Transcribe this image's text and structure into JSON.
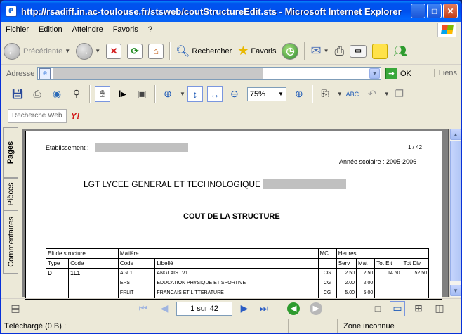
{
  "window": {
    "title": "http://rsadiff.in.ac-toulouse.fr/stsweb/coutStructureEdit.sts - Microsoft Internet Explorer",
    "minimize": "_",
    "maximize": "□",
    "close": "✕"
  },
  "menu": {
    "items": [
      "Fichier",
      "Edition",
      "Atteindre",
      "Favoris",
      "?"
    ]
  },
  "toolbar": {
    "back_label": "Précédente",
    "search_label": "Rechercher",
    "favorites_label": "Favoris"
  },
  "address": {
    "label": "Adresse",
    "go_label": "OK",
    "links_label": "Liens"
  },
  "pdf_toolbar": {
    "zoom_value": "75%"
  },
  "search_bar": {
    "button_label": "Recherche Web",
    "yahoo_label": "Y!"
  },
  "side_tabs": {
    "pages": "Pages",
    "attachments": "Pièces",
    "comments": "Commentaires"
  },
  "pdf": {
    "establishment_label": "Etablissement :",
    "page_count": "1 / 42",
    "school_year": "Année scolaire : 2005-2006",
    "school_name": "LGT LYCEE GENERAL ET TECHNOLOGIQUE",
    "doc_title": "COUT DE LA STRUCTURE",
    "table": {
      "header1": [
        "Elt de structure",
        "Matière",
        "MC",
        "Heures"
      ],
      "header2": [
        "Type",
        "Code",
        "Code",
        "Libellé",
        "Serv",
        "Mat",
        "Tot Elt",
        "Tot Div"
      ],
      "rows": [
        {
          "type": "D",
          "code": "1L1",
          "mcode": "AGL1",
          "libelle": "ANGLAIS LV1",
          "mc": "CG",
          "serv": "2.50",
          "mat": "2.50",
          "tot_elt": "14.50",
          "tot_div": "52.50"
        },
        {
          "type": "",
          "code": "",
          "mcode": "EPS",
          "libelle": "EDUCATION PHYSIQUE ET SPORTIVE",
          "mc": "CG",
          "serv": "2.00",
          "mat": "2.00",
          "tot_elt": "",
          "tot_div": ""
        },
        {
          "type": "",
          "code": "",
          "mcode": "FRLIT",
          "libelle": "FRANCAIS ET LITTERATURE",
          "mc": "CG",
          "serv": "5.00",
          "mat": "5.00",
          "tot_elt": "",
          "tot_div": ""
        }
      ]
    }
  },
  "navigation": {
    "page_indicator": "1 sur 42"
  },
  "status": {
    "main": "Téléchargé  (0 B) :",
    "zone": "Zone inconnue"
  }
}
